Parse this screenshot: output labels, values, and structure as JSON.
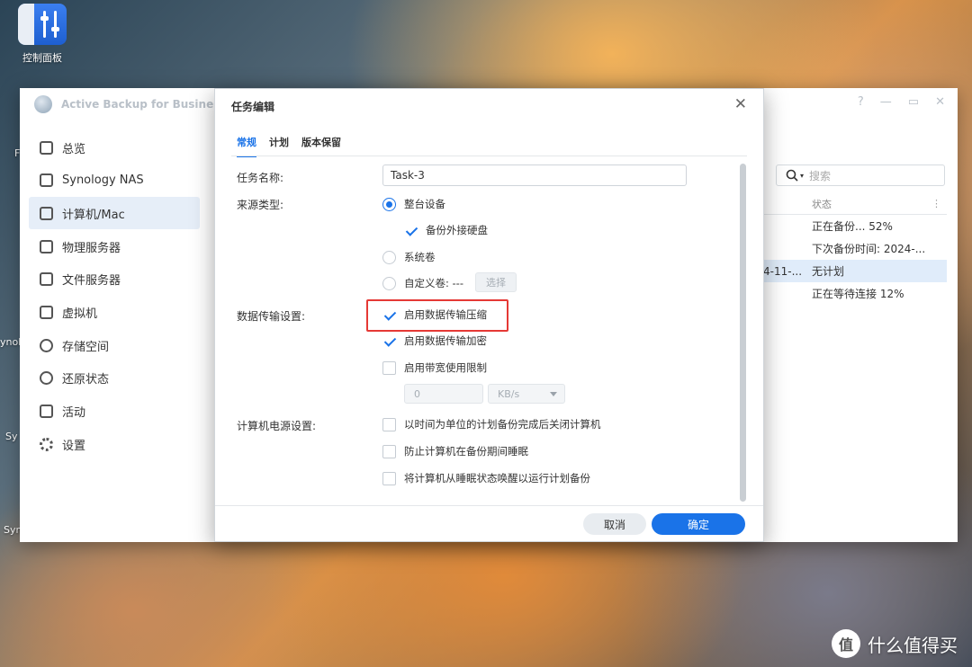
{
  "desktop": {
    "icon_label": "控制面板",
    "side_labels": [
      "F",
      "ynolo",
      "Sy",
      "Syn"
    ]
  },
  "app": {
    "title": "Active Backup for Business",
    "controls": [
      "?",
      "—",
      "▭",
      "✕"
    ],
    "sidebar": [
      {
        "label": "总览",
        "icon": "overview-icon"
      },
      {
        "label": "Synology NAS",
        "icon": "nas-icon"
      },
      {
        "label": "计算机/Mac",
        "icon": "computer-icon",
        "active": true
      },
      {
        "label": "物理服务器",
        "icon": "server-icon"
      },
      {
        "label": "文件服务器",
        "icon": "file-server-icon"
      },
      {
        "label": "虚拟机",
        "icon": "vm-icon"
      },
      {
        "label": "存储空间",
        "icon": "storage-icon"
      },
      {
        "label": "还原状态",
        "icon": "restore-icon"
      },
      {
        "label": "活动",
        "icon": "activity-icon"
      },
      {
        "label": "设置",
        "icon": "gear-icon"
      }
    ],
    "search_placeholder": "搜索",
    "table": {
      "status_header": "状态",
      "rows": [
        {
          "c1": "",
          "status": "正在备份... 52%"
        },
        {
          "c1": "",
          "status": "下次备份时间: 2024-..."
        },
        {
          "c1": "4-11-...",
          "status": "无计划",
          "selected": true
        },
        {
          "c1": "",
          "status": "正在等待连接 12%"
        }
      ]
    }
  },
  "dialog": {
    "title": "任务编辑",
    "tabs": [
      "常规",
      "计划",
      "版本保留"
    ],
    "labels": {
      "task_name": "任务名称:",
      "source_type": "来源类型:",
      "transfer": "数据传输设置:",
      "power": "计算机电源设置:"
    },
    "task_name_value": "Task-3",
    "source_options": {
      "whole_device": "整台设备",
      "external_disk": "备份外接硬盘",
      "system_volume": "系统卷",
      "custom_volume": "自定义卷: ---",
      "select_button": "选择"
    },
    "transfer_options": {
      "compression": "启用数据传输压缩",
      "encryption": "启用数据传输加密",
      "bandwidth": "启用带宽使用限制",
      "bandwidth_value": "0",
      "bandwidth_unit": "KB/s"
    },
    "power_options": {
      "shutdown": "以时间为单位的计划备份完成后关闭计算机",
      "prevent_sleep": "防止计算机在备份期间睡眠",
      "wake": "将计算机从睡眠状态唤醒以运行计划备份"
    },
    "buttons": {
      "cancel": "取消",
      "ok": "确定"
    }
  },
  "watermark": {
    "logo": "值",
    "text": "什么值得买"
  }
}
